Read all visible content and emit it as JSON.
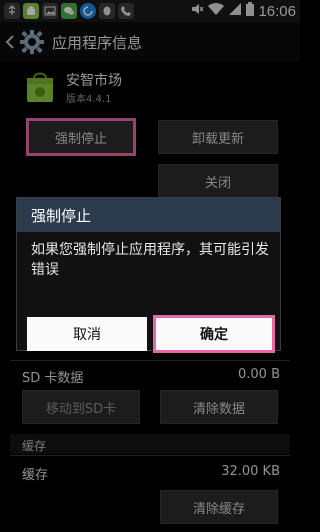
{
  "status_bar": {
    "time": "16:06",
    "left_icons": [
      "usb-icon",
      "android-icon",
      "image-icon",
      "wechat-icon",
      "update-icon",
      "qq-icon",
      "phone-icon"
    ],
    "right_icons": [
      "mute-icon",
      "wifi-icon",
      "signal-icon",
      "battery-icon"
    ]
  },
  "action_bar": {
    "title": "应用程序信息"
  },
  "app": {
    "name": "安智市场",
    "version": "版本4.4.1"
  },
  "buttons": {
    "force_stop": "强制停止",
    "uninstall_updates": "卸载更新",
    "disable": "关闭",
    "move_to_sd": "移动到SD卡",
    "clear_data": "清除数据",
    "clear_cache": "清除缓存"
  },
  "storage": {
    "sd_card_data_label": "SD 卡数据",
    "sd_card_data_value": "0.00 B"
  },
  "cache": {
    "section_title": "缓存",
    "cache_label": "缓存",
    "cache_value": "32.00 KB"
  },
  "dialog": {
    "title": "强制停止",
    "message": "如果您强制停止应用程序，其可能引发错误",
    "cancel": "取消",
    "confirm": "确定"
  },
  "colors": {
    "highlight": "#e46aa6",
    "dialog_title_bg": "#2c3a4e"
  }
}
